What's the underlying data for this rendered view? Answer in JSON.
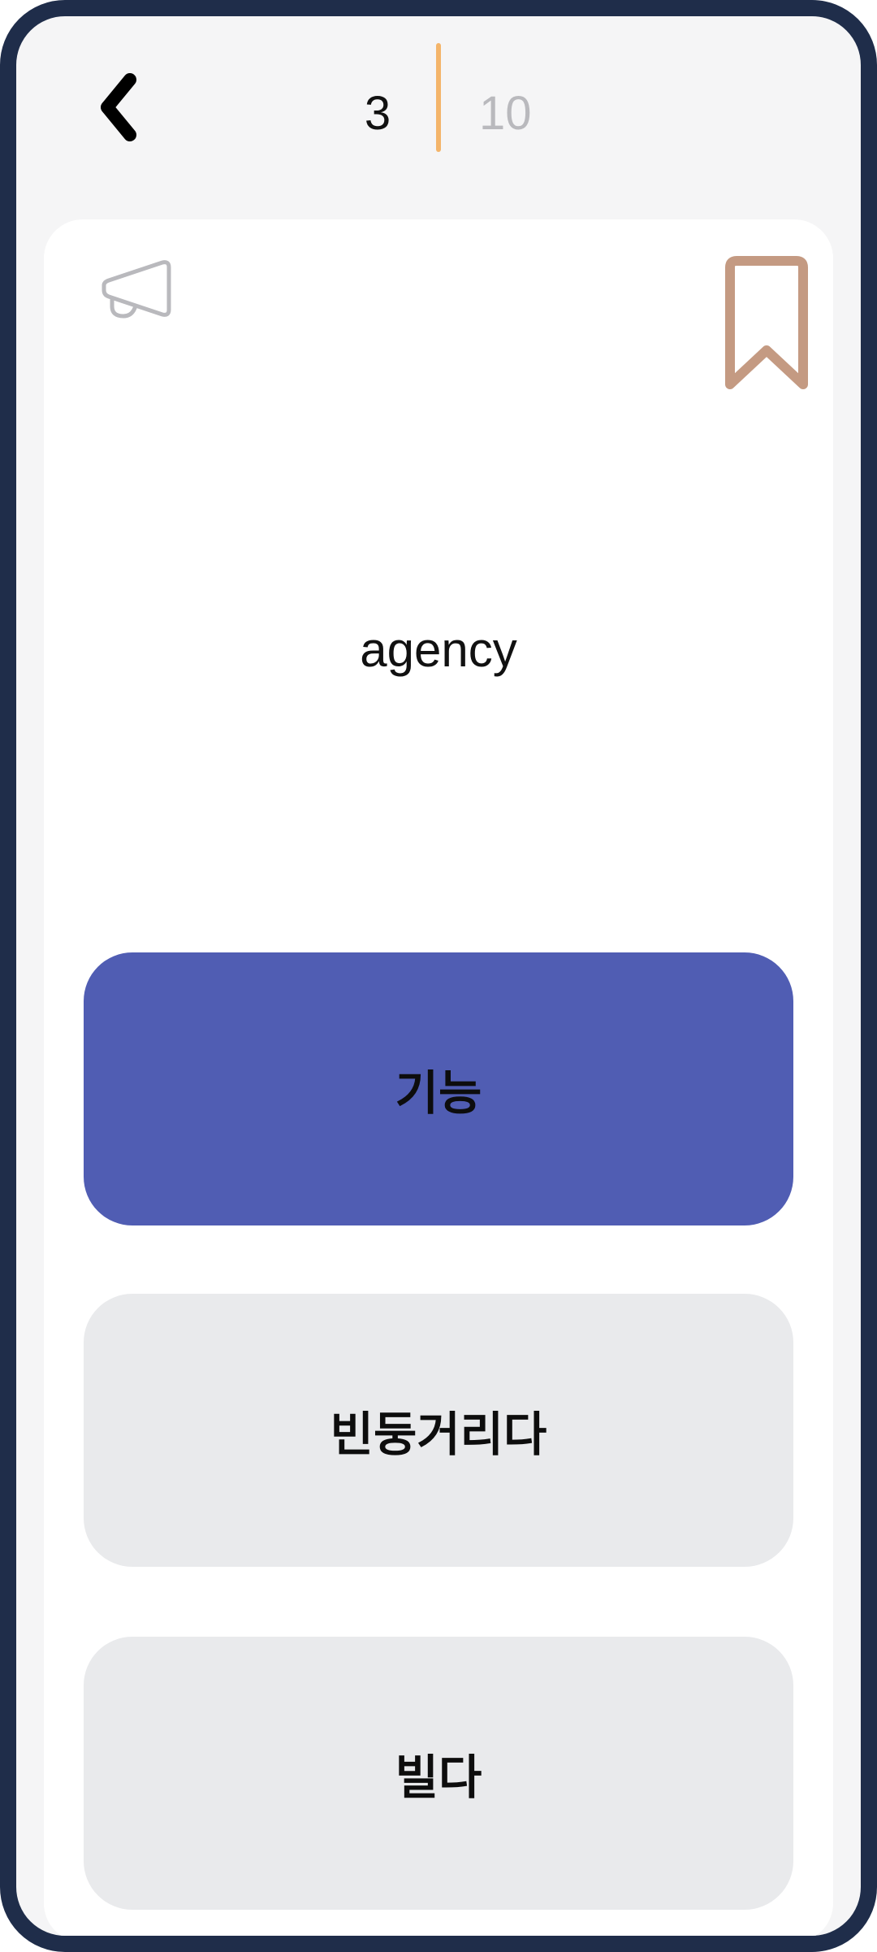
{
  "header": {
    "back_icon": "chevron-left-icon",
    "current": "3",
    "total": "10"
  },
  "colors": {
    "frame": "#1f2d4a",
    "progress_divider": "#f4b56a",
    "bookmark": "#c49a82",
    "selected_option": "#505db3",
    "option_bg": "#e9eaec"
  },
  "card": {
    "speaker_icon": "megaphone-icon",
    "bookmark_icon": "bookmark-icon",
    "word": "agency"
  },
  "options": [
    {
      "label": "기능",
      "selected": true
    },
    {
      "label": "빈둥거리다",
      "selected": false
    },
    {
      "label": "빌다",
      "selected": false
    }
  ]
}
